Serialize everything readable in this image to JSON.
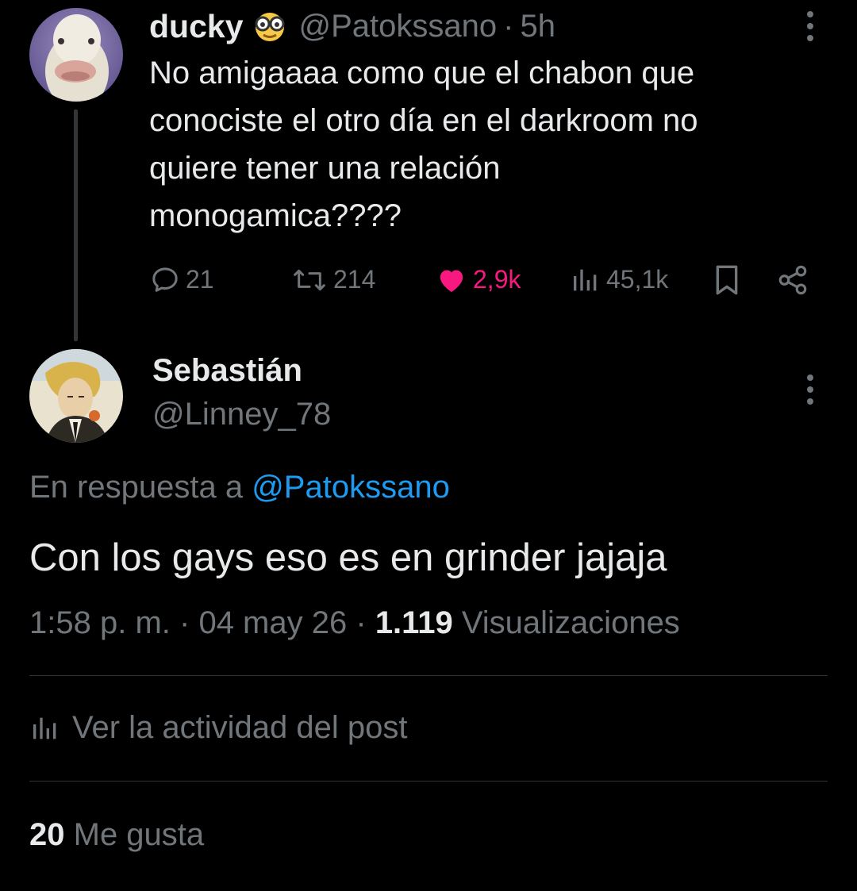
{
  "parent_tweet": {
    "display_name": "ducky",
    "name_emoji": "nerd-glasses-emoji",
    "handle": "@Patokssano",
    "separator": "·",
    "time_ago": "5h",
    "text_lines": [
      "No amigaaaa como que el chabon que",
      "conociste el otro día en el darkroom no",
      "quiere tener una relación",
      "monogamica????"
    ],
    "actions": {
      "replies": "21",
      "reposts": "214",
      "likes": "2,9k",
      "views": "45,1k"
    },
    "colors": {
      "like": "#f91880"
    }
  },
  "reply_tweet": {
    "display_name": "Sebastián",
    "handle": "@Linney_78",
    "reply_to_prefix": "En respuesta a",
    "reply_to_handle": "@Patokssano",
    "text": "Con los gays eso es en grinder jajaja",
    "time": "1:58 p. m.",
    "date": "04 may 26",
    "separator": "·",
    "views_count": "1.119",
    "views_label": "Visualizaciones",
    "activity_label": "Ver la actividad del post",
    "likes_count": "20",
    "likes_label": "Me gusta"
  },
  "colors": {
    "background": "#000000",
    "text": "#e7e9ea",
    "muted": "#71767b",
    "link": "#1d9bf0"
  }
}
